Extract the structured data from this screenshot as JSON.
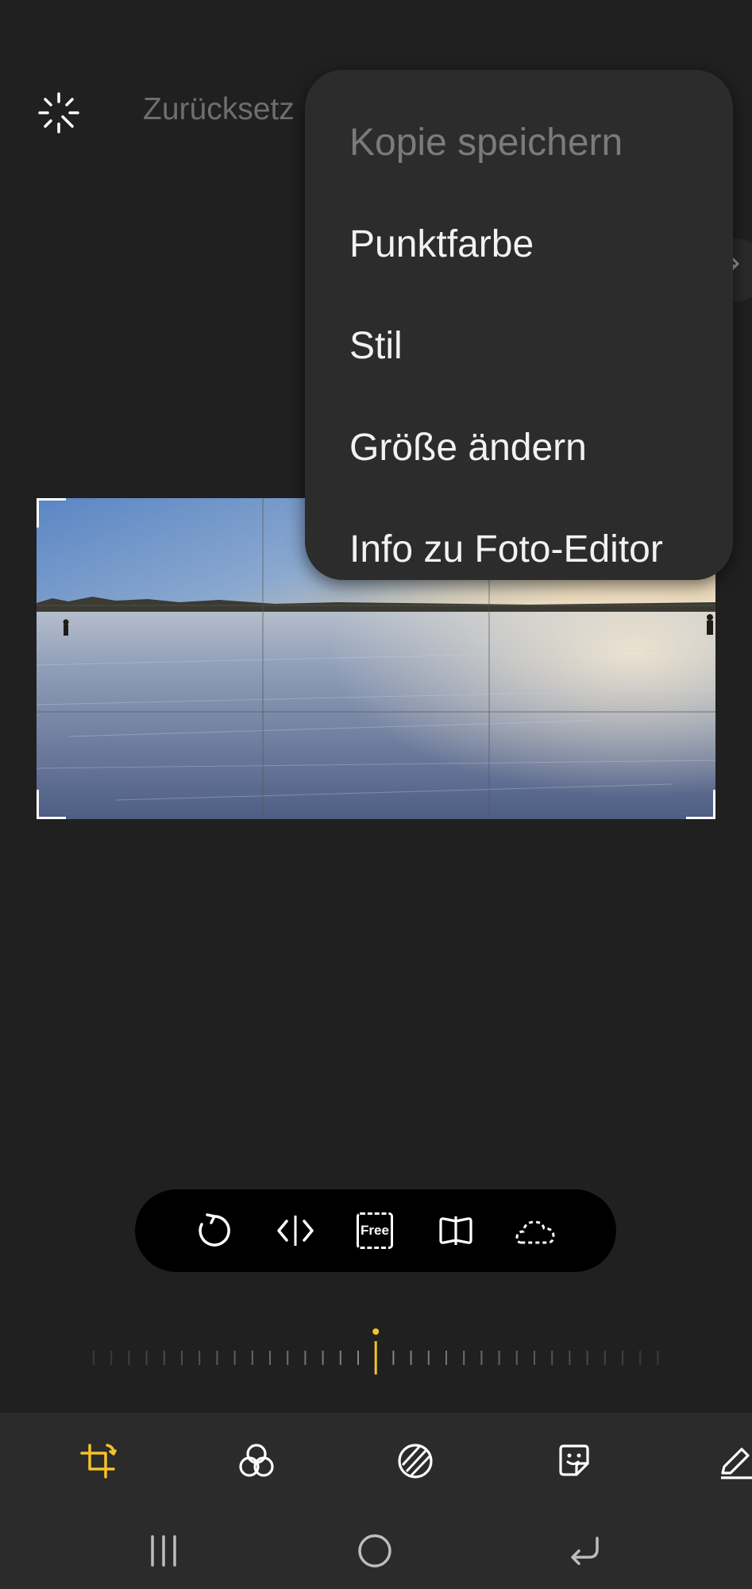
{
  "top_bar": {
    "auto_icon": "auto-enhance-icon",
    "reset_label": "Zurücksetz"
  },
  "overflow_menu": {
    "items": [
      {
        "label": "Kopie speichern",
        "enabled": false
      },
      {
        "label": "Punktfarbe",
        "enabled": true
      },
      {
        "label": "Stil",
        "enabled": true
      },
      {
        "label": "Größe ändern",
        "enabled": true
      },
      {
        "label": "Info zu Foto-Editor",
        "enabled": true
      }
    ]
  },
  "edit_button": {
    "icon": "pencil-icon"
  },
  "photo": {
    "description_icon": "photo-frozen-lake"
  },
  "crop_tools": {
    "items": [
      {
        "icon": "rotate-icon"
      },
      {
        "icon": "flip-icon"
      },
      {
        "icon": "aspect-ratio-icon",
        "label": "Free"
      },
      {
        "icon": "perspective-icon"
      },
      {
        "icon": "lasso-crop-icon"
      }
    ]
  },
  "straighten": {
    "value": 0
  },
  "editor_tabs": {
    "items": [
      {
        "icon": "crop-rotate-icon",
        "active": true
      },
      {
        "icon": "filters-icon",
        "active": false
      },
      {
        "icon": "tone-icon",
        "active": false
      },
      {
        "icon": "sticker-icon",
        "active": false
      },
      {
        "icon": "draw-icon",
        "active": false
      }
    ]
  },
  "nav_bar": {
    "items": [
      {
        "icon": "recent-apps-icon"
      },
      {
        "icon": "home-icon"
      },
      {
        "icon": "back-icon"
      }
    ]
  },
  "colors": {
    "background": "#202020",
    "accent": "#f4c22b",
    "menu_bg": "#2c2c2c"
  }
}
